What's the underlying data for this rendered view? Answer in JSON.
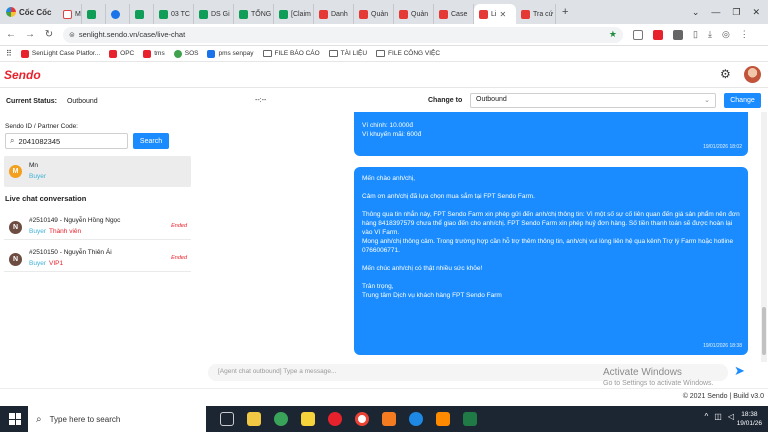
{
  "browser": {
    "brand": "Cốc Cốc",
    "tabs": [
      {
        "label": "M",
        "icon": "gmail-icon"
      },
      {
        "label": "",
        "icon": "sheet-icon"
      },
      {
        "label": "",
        "icon": "messenger-icon"
      },
      {
        "label": "",
        "icon": "sheet-icon"
      },
      {
        "label": "03 TC",
        "icon": "sheet-icon"
      },
      {
        "label": "DS Gi",
        "icon": "sheet-icon"
      },
      {
        "label": "TỔNG",
        "icon": "sheet-icon"
      },
      {
        "label": "[Claim",
        "icon": "sheet-icon"
      },
      {
        "label": "Danh",
        "icon": "sendo-icon"
      },
      {
        "label": "Quản",
        "icon": "sendo-icon"
      },
      {
        "label": "Quản",
        "icon": "sendo-icon"
      },
      {
        "label": "Case",
        "icon": "sendo-icon"
      },
      {
        "label": "Li",
        "icon": "sendo-icon",
        "active": true
      },
      {
        "label": "Tra cứ",
        "icon": "sendo-icon"
      }
    ],
    "new_tab": "+",
    "url": "senlight.sendo.vn/case/live-chat",
    "bookmarks": [
      "SenLight Case Platfor...",
      "OPC",
      "tms",
      "SOS",
      "pms senpay",
      "FILE BÁO CÁO",
      "TÀI LIỆU",
      "FILE CÔNG VIỆC"
    ]
  },
  "app": {
    "logo": "Sendo",
    "status_label": "Current Status:",
    "status_value": "Outbound",
    "status_dashes": "--:--",
    "change_to_label": "Change to",
    "change_to_value": "Outbound",
    "change_button": "Change"
  },
  "left": {
    "sendo_id_label": "Sendo ID / Partner Code:",
    "sendo_id_value": "2041082345",
    "search_button": "Search",
    "buyer": {
      "initial": "M",
      "name": "Mn",
      "tag": "Buyer"
    },
    "conversation_title": "Live chat conversation",
    "conversations": [
      {
        "initial": "N",
        "title": "#2510149 - Nguyễn Hồng Ngọc",
        "tag": "Buyer",
        "level": "Thành viên",
        "status": "Ended"
      },
      {
        "initial": "N",
        "title": "#2510150 - Nguyễn Thiên Ái",
        "tag": "Buyer",
        "level": "VIP1",
        "status": "Ended"
      }
    ]
  },
  "chat": {
    "message1": {
      "lines": [
        "Ví chính: 10.000đ",
        "Ví khuyến mãi: 600đ"
      ],
      "time": "19/01/2026 18:02"
    },
    "message2": {
      "greeting": "Mến chào anh/chị,",
      "thanks": "Cảm ơn anh/chị đã lựa chọn mua sắm tại FPT Sendo Farm.",
      "body": "Thông qua tin nhắn này, FPT Sendo Farm xin phép gửi đến anh/chị thông tin: Vì một số sự cố liên quan đến giá sản phẩm nên đơn hàng 8418397579 chưa thể giao đến cho anh/chị. FPT Sendo Farm xin phép huỷ đơn hàng. Số tiền thanh toán sẽ được hoàn lại vào Ví Farm.",
      "support": "Mong anh/chị thông cảm. Trong trường hợp cần hỗ trợ thêm thông tin, anh/chị vui lòng liên hệ qua kênh Trợ lý Farm hoặc hotline 0766006771.",
      "wish": "Mến chúc anh/chị có thật nhiều sức khỏe!",
      "regards": "Trân trọng,",
      "signature": "Trung tâm Dịch vụ khách hàng FPT Sendo Farm",
      "time": "19/01/2026 18:38"
    },
    "input_placeholder": "[Agent chat outbound] Type a message...",
    "watermark_title": "Activate Windows",
    "watermark_sub": "Go to Settings to activate Windows.",
    "copyright": "© 2021 Sendo | Build v3.0"
  },
  "taskbar": {
    "search_placeholder": "Type here to search",
    "time": "18:38",
    "date": "19/01/26"
  }
}
